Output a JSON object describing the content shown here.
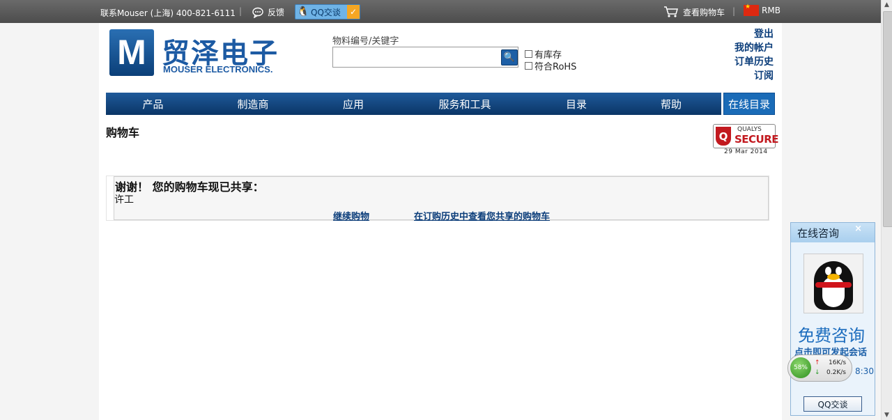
{
  "topbar": {
    "contact": "联系Mouser (上海)  400-821-6111",
    "separator": "|",
    "feedback": "反馈",
    "qq_chat": "QQ交谈",
    "view_cart": "查看购物车",
    "currency": "RMB"
  },
  "header": {
    "logo_letter": "M",
    "logo_cn": "贸泽电子",
    "logo_en": "MOUSER ELECTRONICS.",
    "search_label": "物料编号/关键字",
    "search_value": "",
    "in_stock": "有库存",
    "rohs": "符合RoHS",
    "account_links": [
      "登出",
      "我的帐户",
      "订单历史",
      "订阅"
    ]
  },
  "nav": {
    "items": [
      "产品",
      "制造商",
      "应用",
      "服务和工具",
      "目录",
      "帮助"
    ],
    "online_catalog": "在线目录"
  },
  "main": {
    "title": "购物车",
    "badge_top": "QUALYS",
    "badge_main": "SECURE",
    "badge_date": "29 Mar 2014",
    "message": "谢谢！ 您的购物车现已共享：",
    "shared_with": "许工",
    "continue_shopping": "继续购物",
    "view_in_history": "在订购历史中查看您共享的购物车"
  },
  "chat_widget": {
    "title": "在线咨询",
    "close": "×",
    "free": "免费咨询",
    "prompt": "点击即可发起会话",
    "time": "8:30",
    "button": "QQ交谈"
  },
  "speed_meter": {
    "percent": "58%",
    "upload": "16K/s",
    "download": "0.2K/s"
  },
  "colors": {
    "brand_blue": "#1c5aa3",
    "nav_blue": "#0a3566",
    "link_blue": "#0b3d7a"
  }
}
